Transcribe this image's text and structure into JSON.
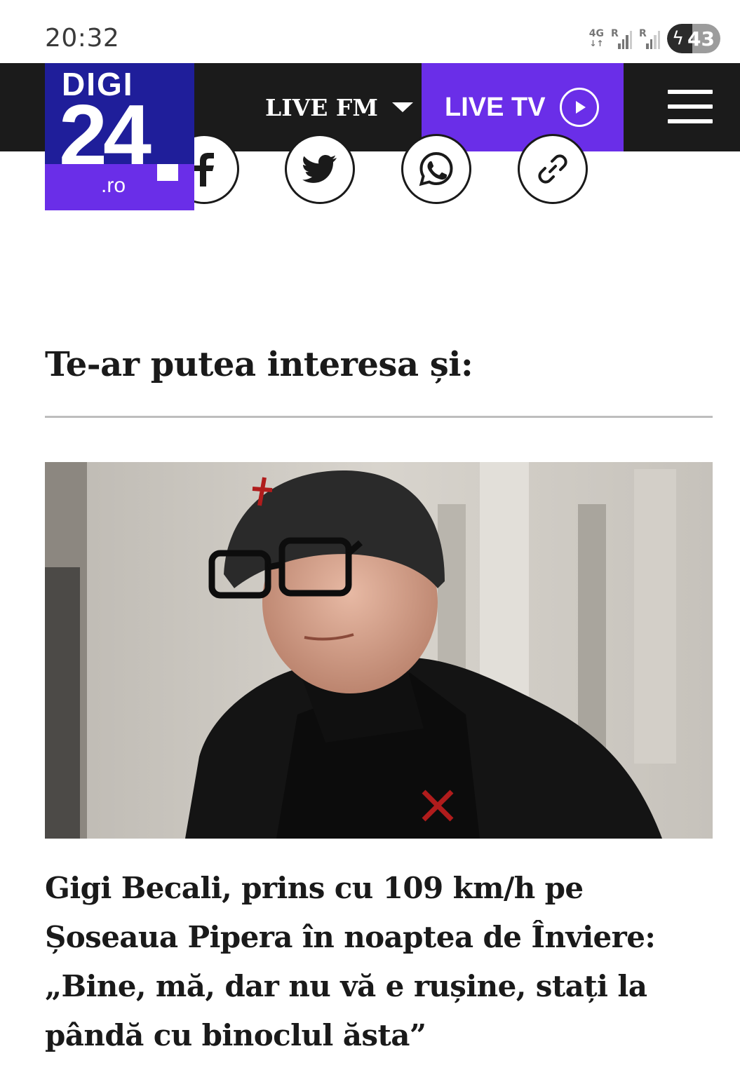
{
  "status_bar": {
    "time": "20:32",
    "network_type": "4G",
    "signal_1_label": "R",
    "signal_2_label": "R",
    "battery_level": "43"
  },
  "header": {
    "logo_brand": "DIGI",
    "logo_number": "24",
    "logo_tld": ".ro",
    "live_fm_label": "LIVE FM",
    "live_tv_label": "LIVE TV",
    "colors": {
      "bar": "#1b1b1b",
      "live_tv": "#6a2ee8",
      "logo_blue": "#1f1e9a"
    }
  },
  "share_buttons": [
    {
      "icon": "facebook-icon"
    },
    {
      "icon": "twitter-icon"
    },
    {
      "icon": "whatsapp-icon"
    },
    {
      "icon": "link-icon"
    }
  ],
  "section": {
    "title": "Te-ar putea interesa și:"
  },
  "article": {
    "image_icon": "article-photo",
    "title": "Gigi Becali, prins cu 109 km/h pe Șoseaua Pipera în noaptea de Înviere: „Bine, mă, dar nu vă e rușine, stați la pândă cu binoclul ăsta”"
  }
}
